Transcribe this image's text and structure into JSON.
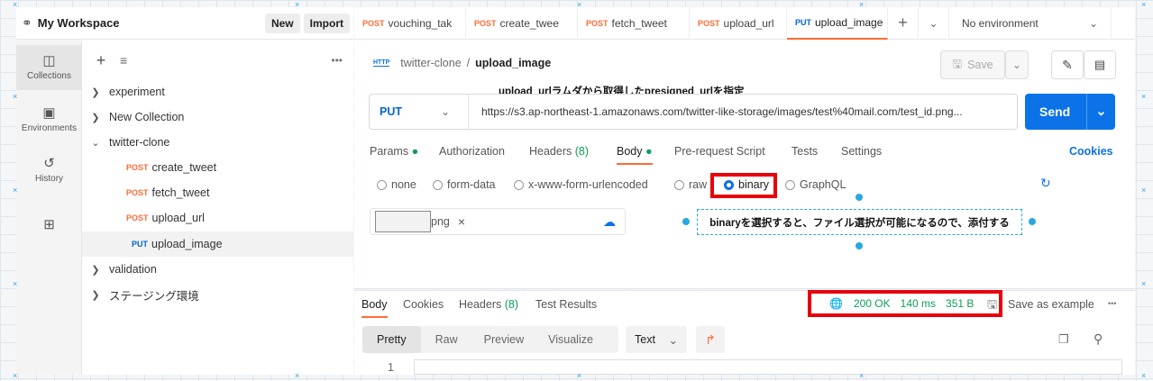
{
  "workspace": {
    "title": "My Workspace",
    "new_label": "New",
    "import_label": "Import"
  },
  "tabs": [
    {
      "method": "POST",
      "name": "vouching_tak"
    },
    {
      "method": "POST",
      "name": "create_twee"
    },
    {
      "method": "POST",
      "name": "fetch_tweet"
    },
    {
      "method": "POST",
      "name": "upload_url"
    },
    {
      "method": "PUT",
      "name": "upload_image"
    }
  ],
  "environment": "No environment",
  "sidebar_nav": {
    "collections": "Collections",
    "environments": "Environments",
    "history": "History"
  },
  "tree": {
    "experiment": "experiment",
    "new_collection": "New Collection",
    "twitter_clone": "twitter-clone",
    "requests": [
      {
        "method": "POST",
        "name": "create_tweet"
      },
      {
        "method": "POST",
        "name": "fetch_tweet"
      },
      {
        "method": "POST",
        "name": "upload_url"
      },
      {
        "method": "PUT",
        "name": "upload_image"
      }
    ],
    "validation": "validation",
    "staging": "ステージング環境"
  },
  "request": {
    "http_badge": "HTTP",
    "breadcrumb_parent": "twitter-clone",
    "breadcrumb_sep": "/",
    "breadcrumb_current": "upload_image",
    "save_label": "Save",
    "method": "PUT",
    "url": "https://s3.ap-northeast-1.amazonaws.com/twitter-like-storage/images/test%40mail.com/test_id.png...",
    "send_label": "Send",
    "annotation_url": "upload_urlラムダから取得したpresigned_urlを指定"
  },
  "req_tabs": {
    "params": "Params",
    "authorization": "Authorization",
    "headers": "Headers",
    "headers_count": "(8)",
    "body": "Body",
    "prerequest": "Pre-request Script",
    "tests": "Tests",
    "settings": "Settings",
    "cookies": "Cookies"
  },
  "body_types": {
    "none": "none",
    "form_data": "form-data",
    "urlencoded": "x-www-form-urlencoded",
    "raw": "raw",
    "binary": "binary",
    "graphql": "GraphQL"
  },
  "file": {
    "name": "png",
    "remove": "×"
  },
  "annotation_binary": "binaryを選択すると、ファイル選択が可能になるので、添付する",
  "response": {
    "body": "Body",
    "cookies": "Cookies",
    "headers": "Headers",
    "headers_count": "(8)",
    "test_results": "Test Results",
    "status": "200 OK",
    "time": "140 ms",
    "size": "351 B",
    "save_example": "Save as example",
    "views": {
      "pretty": "Pretty",
      "raw": "Raw",
      "preview": "Preview",
      "visualize": "Visualize"
    },
    "format": "Text",
    "line_no": "1"
  },
  "colors": {
    "accent": "#ff6c37",
    "primary": "#0b72e7",
    "success": "#0f9d58",
    "annotation_red": "#e8000b"
  }
}
